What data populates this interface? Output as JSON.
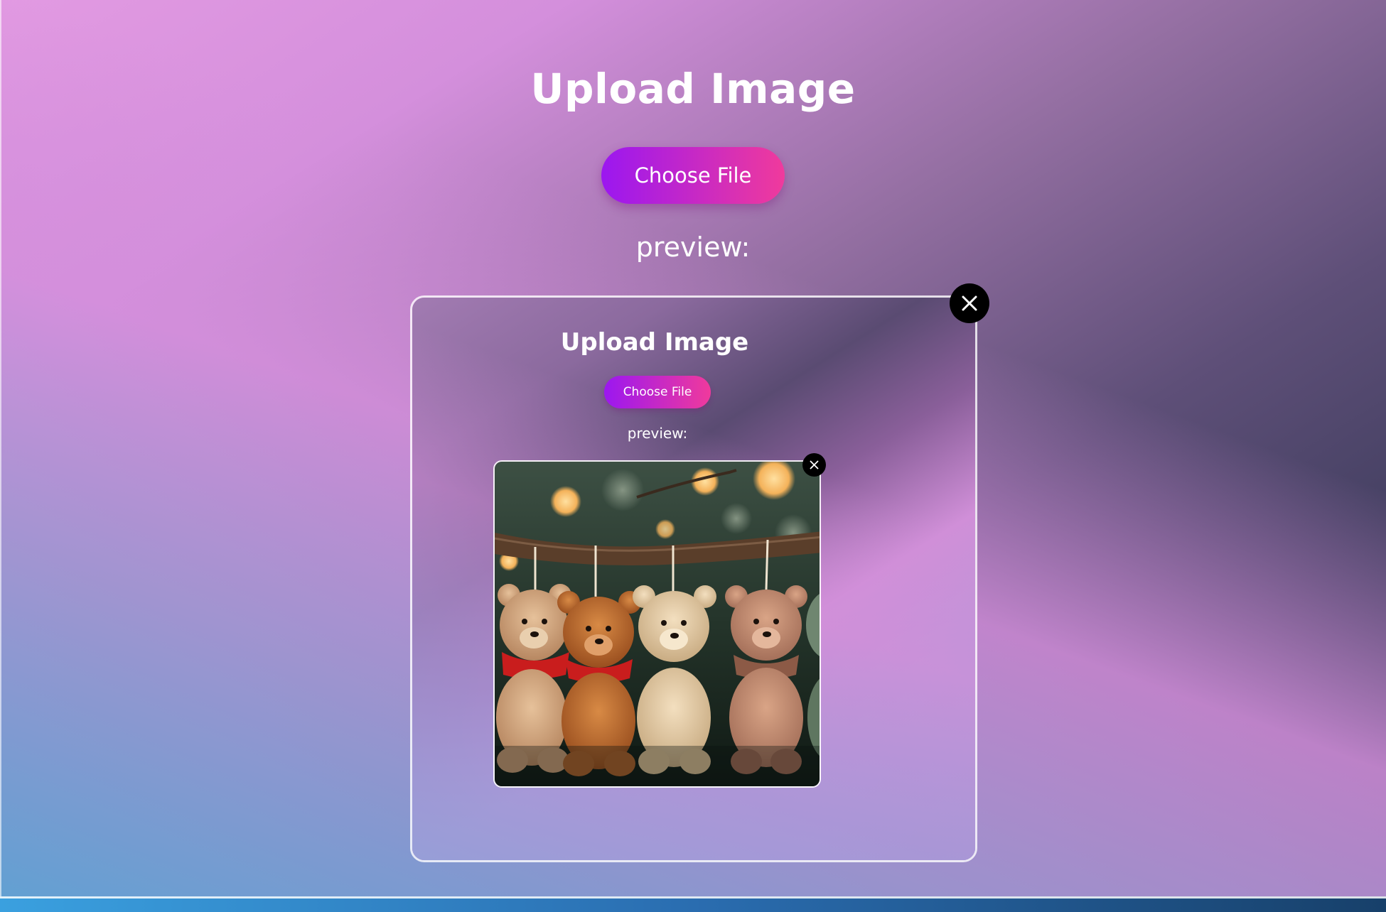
{
  "header": {
    "title": "Upload Image",
    "choose_file_label": "Choose File",
    "preview_label": "preview:"
  },
  "preview": {
    "close_icon": "close-icon",
    "nested": {
      "title": "Upload Image",
      "choose_file_label": "Choose File",
      "preview_label": "preview:",
      "close_icon": "close-icon"
    }
  },
  "colors": {
    "button_gradient_start": "#9b17f0",
    "button_gradient_end": "#f03a9c",
    "close_button_bg": "#000000"
  }
}
